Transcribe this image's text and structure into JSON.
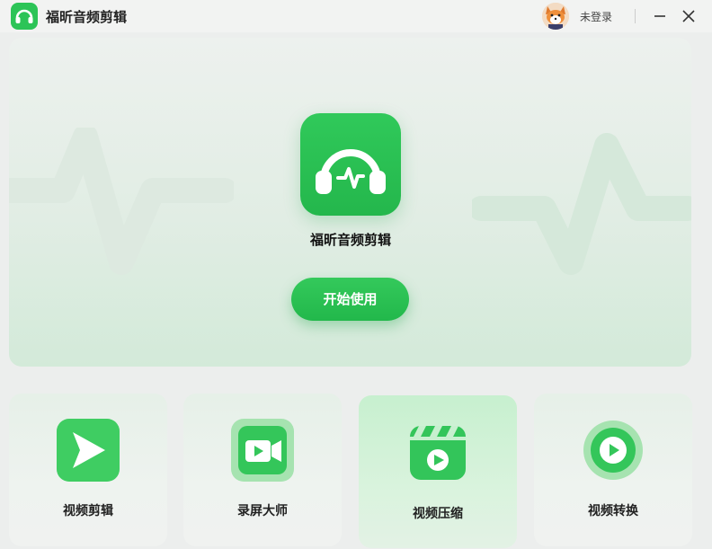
{
  "app": {
    "title": "福昕音频剪辑",
    "accent_color": "#2cc457"
  },
  "header": {
    "login_text": "未登录",
    "avatar_icon": "fox-avatar-icon",
    "minimize_icon": "minimize-icon",
    "close_icon": "close-icon"
  },
  "hero": {
    "icon": "headphones-waveform-icon",
    "title": "福昕音频剪辑",
    "start_button_label": "开始使用"
  },
  "features": [
    {
      "label": "视频剪辑",
      "icon": "play-chevron-icon"
    },
    {
      "label": "录屏大师",
      "icon": "video-camera-icon"
    },
    {
      "label": "视频压缩",
      "icon": "clapperboard-icon"
    },
    {
      "label": "视频转换",
      "icon": "circular-play-icon"
    }
  ]
}
